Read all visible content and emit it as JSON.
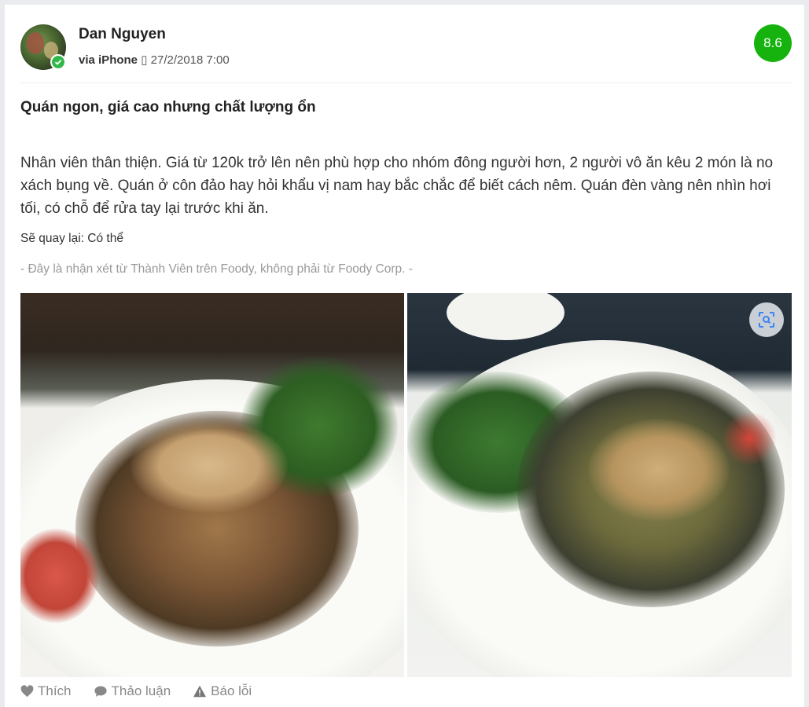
{
  "review": {
    "user_name": "Dan Nguyen",
    "via": "via iPhone",
    "device_glyph": "▯",
    "timestamp": "27/2/2018 7:00",
    "score": "8.6",
    "title": "Quán ngon, giá cao nhưng chất lượng ổn",
    "body": "Nhân viên thân thiện. Giá từ 120k trở lên nên phù hợp cho nhóm đông người hơn, 2 người vô ăn kêu 2 món là no xách bụng về. Quán ở côn đảo hay hỏi khẩu vị nam hay bắc chắc để biết cách nêm. Quán đèn vàng nên nhìn hơi tối, có chỗ để rửa tay lại trước khi ăn.",
    "revisit": "Sẽ quay lại: Có thể",
    "disclaimer": "- Đây là nhận xét từ Thành Viên trên Foody, không phải từ Foody Corp. -"
  },
  "actions": {
    "like_label": "Thích",
    "discuss_label": "Thảo luận",
    "report_label": "Báo lỗi"
  },
  "icons": {
    "verified": "check-badge-icon",
    "scan": "scan-icon",
    "like": "heart-icon",
    "discuss": "comment-icon",
    "report": "warning-icon"
  },
  "colors": {
    "score_bg": "#16b30f",
    "verified": "#32b84a",
    "muted": "#999999"
  }
}
